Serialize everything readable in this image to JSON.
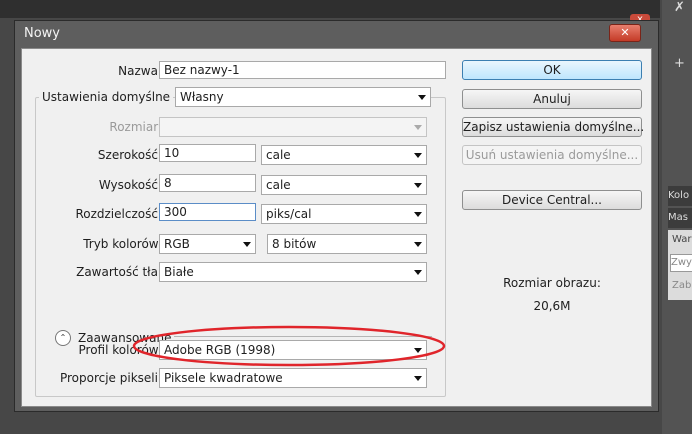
{
  "dialog": {
    "title": "Nowy",
    "close_glyph": "✕"
  },
  "background": {
    "close_glyph": "x",
    "panel_tabs": [
      "Kolo",
      "Mas"
    ],
    "panel_label": "Wars",
    "panel_field": "Zwy",
    "panel_hint": "Zabl",
    "tool_glyphs": [
      "✗",
      "+"
    ]
  },
  "form": {
    "name": {
      "label": "Nazwa:",
      "value": "Bez nazwy-1"
    },
    "preset": {
      "legend": "Ustawienia domyślne",
      "value": "Własny"
    },
    "size": {
      "label": "Rozmiar:",
      "value": ""
    },
    "width": {
      "label": "Szerokość:",
      "value": "10",
      "unit": "cale"
    },
    "height": {
      "label": "Wysokość:",
      "value": "8",
      "unit": "cale"
    },
    "resolution": {
      "label": "Rozdzielczość:",
      "value": "300",
      "unit": "piks/cal"
    },
    "color_mode": {
      "label": "Tryb kolorów:",
      "value": "RGB",
      "depth": "8 bitów"
    },
    "background_contents": {
      "label": "Zawartość tła:",
      "value": "Białe"
    },
    "advanced": {
      "label": "Zaawansowane",
      "toggle_glyph": "⌃"
    },
    "color_profile": {
      "label": "Profil kolorów:",
      "value": "Adobe RGB (1998)"
    },
    "pixel_aspect": {
      "label": "Proporcje pikseli:",
      "value": "Piksele kwadratowe"
    }
  },
  "buttons": {
    "ok": "OK",
    "cancel": "Anuluj",
    "save_preset": "Zapisz ustawienia domyślne...",
    "delete_preset": "Usuń ustawienia domyślne...",
    "device_central": "Device Central..."
  },
  "image_size": {
    "label": "Rozmiar obrazu:",
    "value": "20,6M"
  },
  "colors": {
    "annotation": "#e0252b",
    "default_button": "#3c7fb1"
  }
}
